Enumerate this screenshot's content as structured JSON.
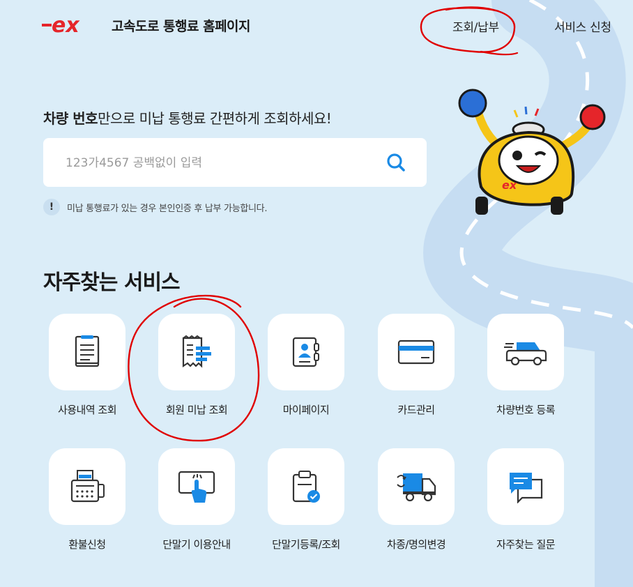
{
  "header": {
    "logo_mark": "ex",
    "title": "고속도로 통행료 홈페이지",
    "nav": [
      "조회/납부",
      "서비스 신청"
    ]
  },
  "search": {
    "headline_bold": "차량 번호",
    "headline_rest": "만으로 미납 통행료 간편하게 조회하세요!",
    "placeholder": "123가4567 공백없이 입력",
    "value": "",
    "notice_icon": "!",
    "notice": "미납 통행료가 있는 경우 본인인증 후 납부 가능합니다."
  },
  "services": {
    "title": "자주찾는 서비스",
    "items": [
      {
        "label": "사용내역 조회",
        "icon": "usage-history-icon"
      },
      {
        "label": "회원 미납 조회",
        "icon": "receipt-icon"
      },
      {
        "label": "마이페이지",
        "icon": "my-page-icon"
      },
      {
        "label": "카드관리",
        "icon": "card-icon"
      },
      {
        "label": "차량번호 등록",
        "icon": "car-icon"
      },
      {
        "label": "환불신청",
        "icon": "refund-icon"
      },
      {
        "label": "단말기 이용안내",
        "icon": "terminal-guide-icon"
      },
      {
        "label": "단말기등록/조회",
        "icon": "terminal-register-icon"
      },
      {
        "label": "차종/명의변경",
        "icon": "truck-icon"
      },
      {
        "label": "자주찾는 질문",
        "icon": "faq-icon"
      }
    ]
  },
  "colors": {
    "background": "#dbedf8",
    "accent_blue": "#1a8ae5",
    "logo_red": "#e5252a",
    "annotation_red": "#e00000",
    "mascot_yellow": "#f5c518"
  }
}
